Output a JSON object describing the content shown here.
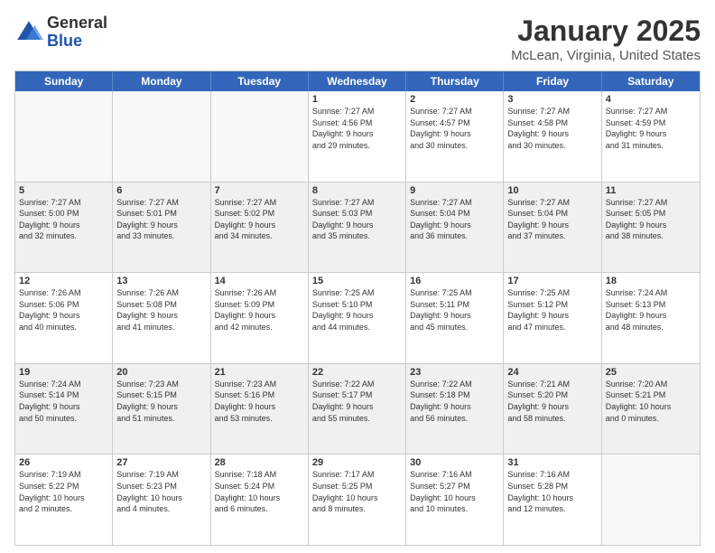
{
  "header": {
    "logo_general": "General",
    "logo_blue": "Blue",
    "month_title": "January 2025",
    "location": "McLean, Virginia, United States"
  },
  "weekdays": [
    "Sunday",
    "Monday",
    "Tuesday",
    "Wednesday",
    "Thursday",
    "Friday",
    "Saturday"
  ],
  "rows": [
    [
      {
        "day": "",
        "info": "",
        "empty": true
      },
      {
        "day": "",
        "info": "",
        "empty": true
      },
      {
        "day": "",
        "info": "",
        "empty": true
      },
      {
        "day": "1",
        "info": "Sunrise: 7:27 AM\nSunset: 4:56 PM\nDaylight: 9 hours\nand 29 minutes."
      },
      {
        "day": "2",
        "info": "Sunrise: 7:27 AM\nSunset: 4:57 PM\nDaylight: 9 hours\nand 30 minutes."
      },
      {
        "day": "3",
        "info": "Sunrise: 7:27 AM\nSunset: 4:58 PM\nDaylight: 9 hours\nand 30 minutes."
      },
      {
        "day": "4",
        "info": "Sunrise: 7:27 AM\nSunset: 4:59 PM\nDaylight: 9 hours\nand 31 minutes."
      }
    ],
    [
      {
        "day": "5",
        "info": "Sunrise: 7:27 AM\nSunset: 5:00 PM\nDaylight: 9 hours\nand 32 minutes."
      },
      {
        "day": "6",
        "info": "Sunrise: 7:27 AM\nSunset: 5:01 PM\nDaylight: 9 hours\nand 33 minutes."
      },
      {
        "day": "7",
        "info": "Sunrise: 7:27 AM\nSunset: 5:02 PM\nDaylight: 9 hours\nand 34 minutes."
      },
      {
        "day": "8",
        "info": "Sunrise: 7:27 AM\nSunset: 5:03 PM\nDaylight: 9 hours\nand 35 minutes."
      },
      {
        "day": "9",
        "info": "Sunrise: 7:27 AM\nSunset: 5:04 PM\nDaylight: 9 hours\nand 36 minutes."
      },
      {
        "day": "10",
        "info": "Sunrise: 7:27 AM\nSunset: 5:04 PM\nDaylight: 9 hours\nand 37 minutes."
      },
      {
        "day": "11",
        "info": "Sunrise: 7:27 AM\nSunset: 5:05 PM\nDaylight: 9 hours\nand 38 minutes."
      }
    ],
    [
      {
        "day": "12",
        "info": "Sunrise: 7:26 AM\nSunset: 5:06 PM\nDaylight: 9 hours\nand 40 minutes."
      },
      {
        "day": "13",
        "info": "Sunrise: 7:26 AM\nSunset: 5:08 PM\nDaylight: 9 hours\nand 41 minutes."
      },
      {
        "day": "14",
        "info": "Sunrise: 7:26 AM\nSunset: 5:09 PM\nDaylight: 9 hours\nand 42 minutes."
      },
      {
        "day": "15",
        "info": "Sunrise: 7:25 AM\nSunset: 5:10 PM\nDaylight: 9 hours\nand 44 minutes."
      },
      {
        "day": "16",
        "info": "Sunrise: 7:25 AM\nSunset: 5:11 PM\nDaylight: 9 hours\nand 45 minutes."
      },
      {
        "day": "17",
        "info": "Sunrise: 7:25 AM\nSunset: 5:12 PM\nDaylight: 9 hours\nand 47 minutes."
      },
      {
        "day": "18",
        "info": "Sunrise: 7:24 AM\nSunset: 5:13 PM\nDaylight: 9 hours\nand 48 minutes."
      }
    ],
    [
      {
        "day": "19",
        "info": "Sunrise: 7:24 AM\nSunset: 5:14 PM\nDaylight: 9 hours\nand 50 minutes."
      },
      {
        "day": "20",
        "info": "Sunrise: 7:23 AM\nSunset: 5:15 PM\nDaylight: 9 hours\nand 51 minutes."
      },
      {
        "day": "21",
        "info": "Sunrise: 7:23 AM\nSunset: 5:16 PM\nDaylight: 9 hours\nand 53 minutes."
      },
      {
        "day": "22",
        "info": "Sunrise: 7:22 AM\nSunset: 5:17 PM\nDaylight: 9 hours\nand 55 minutes."
      },
      {
        "day": "23",
        "info": "Sunrise: 7:22 AM\nSunset: 5:18 PM\nDaylight: 9 hours\nand 56 minutes."
      },
      {
        "day": "24",
        "info": "Sunrise: 7:21 AM\nSunset: 5:20 PM\nDaylight: 9 hours\nand 58 minutes."
      },
      {
        "day": "25",
        "info": "Sunrise: 7:20 AM\nSunset: 5:21 PM\nDaylight: 10 hours\nand 0 minutes."
      }
    ],
    [
      {
        "day": "26",
        "info": "Sunrise: 7:19 AM\nSunset: 5:22 PM\nDaylight: 10 hours\nand 2 minutes."
      },
      {
        "day": "27",
        "info": "Sunrise: 7:19 AM\nSunset: 5:23 PM\nDaylight: 10 hours\nand 4 minutes."
      },
      {
        "day": "28",
        "info": "Sunrise: 7:18 AM\nSunset: 5:24 PM\nDaylight: 10 hours\nand 6 minutes."
      },
      {
        "day": "29",
        "info": "Sunrise: 7:17 AM\nSunset: 5:25 PM\nDaylight: 10 hours\nand 8 minutes."
      },
      {
        "day": "30",
        "info": "Sunrise: 7:16 AM\nSunset: 5:27 PM\nDaylight: 10 hours\nand 10 minutes."
      },
      {
        "day": "31",
        "info": "Sunrise: 7:16 AM\nSunset: 5:28 PM\nDaylight: 10 hours\nand 12 minutes."
      },
      {
        "day": "",
        "info": "",
        "empty": true
      }
    ]
  ]
}
